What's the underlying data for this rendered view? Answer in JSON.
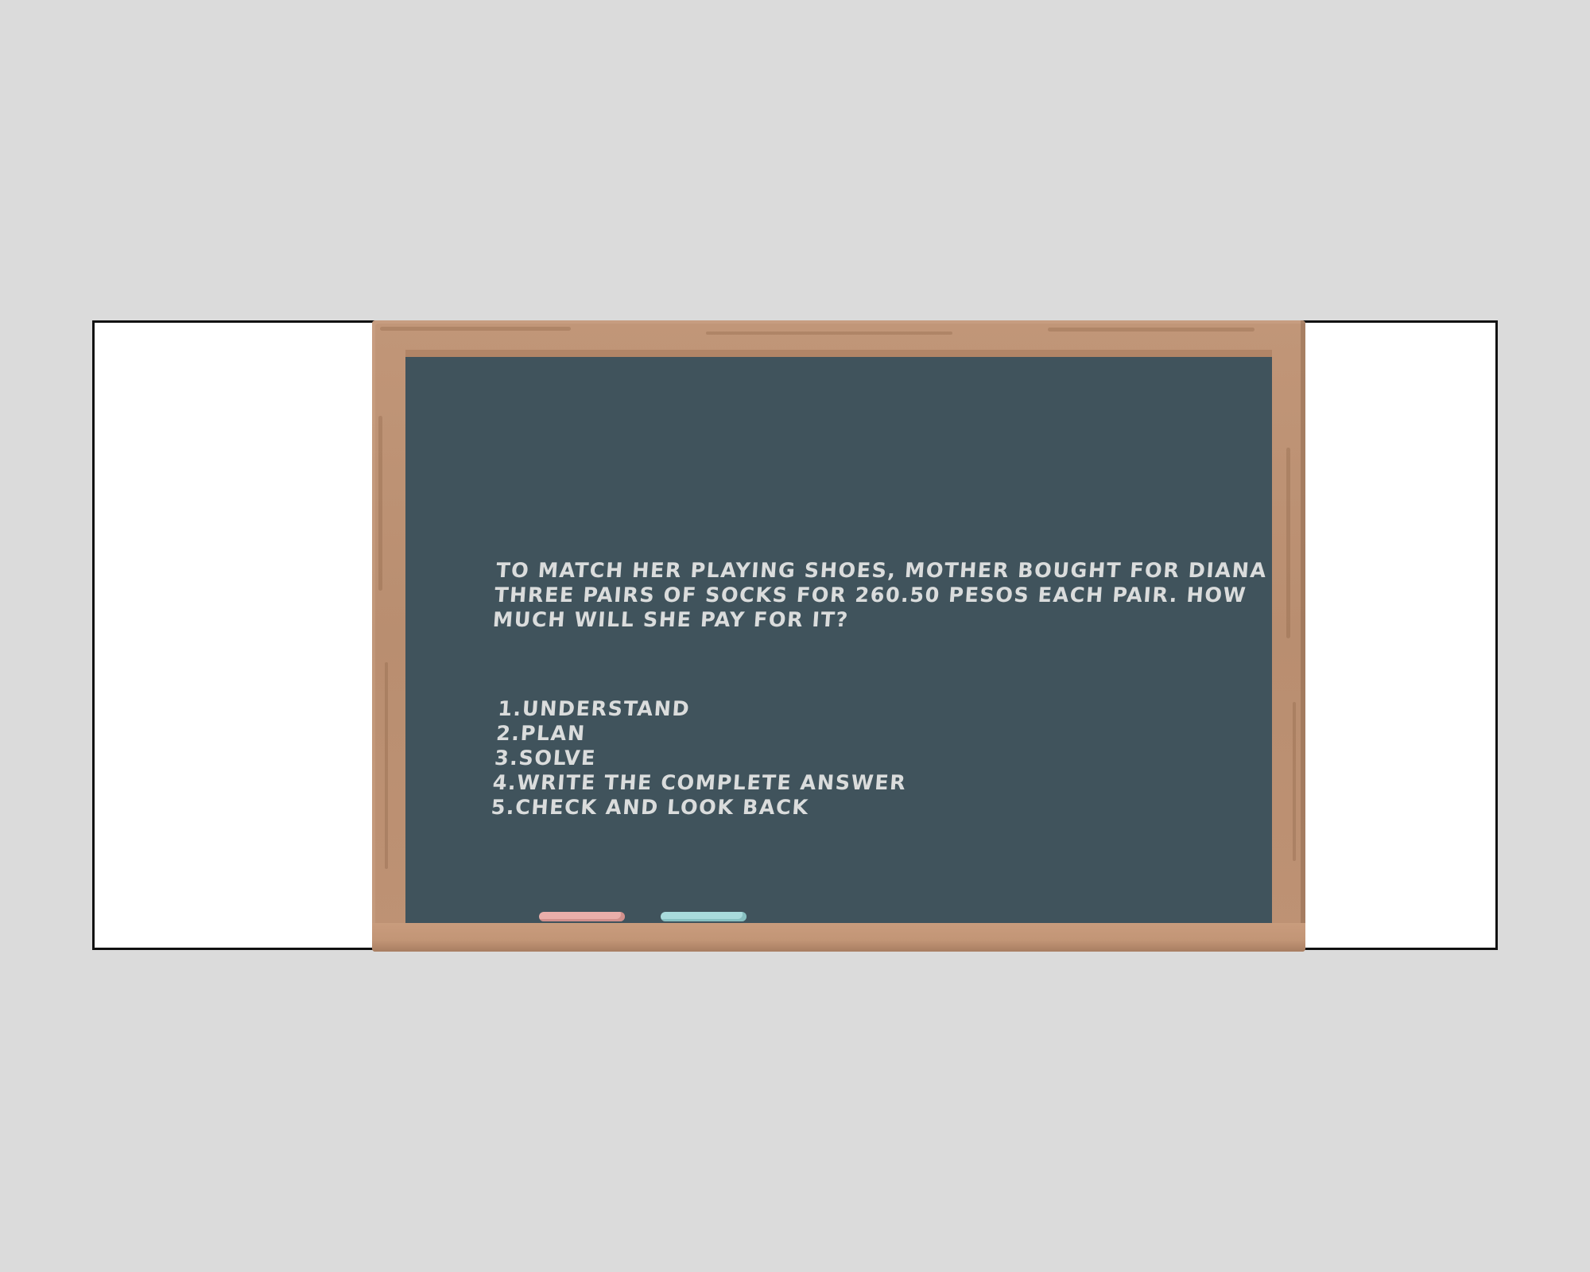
{
  "colors": {
    "background": "#dbdbdb",
    "slide": "#ffffff",
    "frame_wood": "#c19678",
    "board": "#40535c",
    "chalk_text": "#dadcdc",
    "chalk_pink": "#e9aeaa",
    "chalk_blue": "#a9dbdc"
  },
  "blackboard": {
    "problem_lines": [
      "TO MATCH HER PLAYING SHOES, MOTHER BOUGHT FOR DIANA",
      "THREE PAIRS OF SOCKS FOR 260.50 PESOS EACH PAIR. HOW",
      "MUCH WILL SHE PAY FOR IT?"
    ],
    "steps": [
      "1.UNDERSTAND",
      "2.PLAN",
      "3.SOLVE",
      "4.WRITE THE COMPLETE ANSWER",
      "5.CHECK AND LOOK BACK"
    ]
  },
  "icons": {
    "chalk_pink": "pink-chalk-icon",
    "chalk_blue": "blue-chalk-icon"
  }
}
